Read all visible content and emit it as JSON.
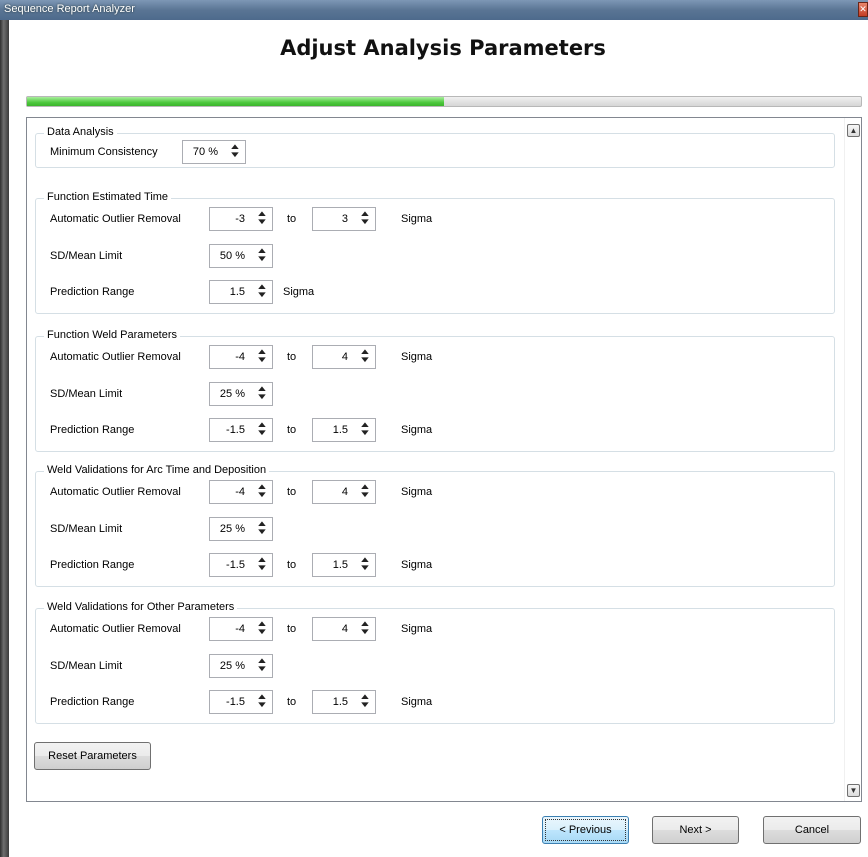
{
  "window": {
    "title": "Sequence Report Analyzer",
    "close_glyph": "✕"
  },
  "page_title": "Adjust Analysis Parameters",
  "progress": {
    "fraction": 0.5
  },
  "groups": [
    {
      "title": "Data Analysis",
      "rows": [
        {
          "label": "Minimum Consistency",
          "from": "70 %"
        }
      ]
    },
    {
      "title": "Function Estimated Time",
      "rows": [
        {
          "label": "Automatic Outlier Removal",
          "from": "-3",
          "to_word": "to",
          "to": "3",
          "unit": "Sigma"
        },
        {
          "label": "SD/Mean Limit",
          "from": "50 %"
        },
        {
          "label": "Prediction Range",
          "from": "1.5",
          "unit": "Sigma"
        }
      ]
    },
    {
      "title": "Function Weld Parameters",
      "rows": [
        {
          "label": "Automatic Outlier Removal",
          "from": "-4",
          "to_word": "to",
          "to": "4",
          "unit": "Sigma"
        },
        {
          "label": "SD/Mean Limit",
          "from": "25 %"
        },
        {
          "label": "Prediction Range",
          "from": "-1.5",
          "to_word": "to",
          "to": "1.5",
          "unit": "Sigma"
        }
      ]
    },
    {
      "title": "Weld Validations for Arc Time and Deposition",
      "rows": [
        {
          "label": "Automatic Outlier Removal",
          "from": "-4",
          "to_word": "to",
          "to": "4",
          "unit": "Sigma"
        },
        {
          "label": "SD/Mean Limit",
          "from": "25 %"
        },
        {
          "label": "Prediction Range",
          "from": "-1.5",
          "to_word": "to",
          "to": "1.5",
          "unit": "Sigma"
        }
      ]
    },
    {
      "title": "Weld Validations for Other Parameters",
      "rows": [
        {
          "label": "Automatic Outlier Removal",
          "from": "-4",
          "to_word": "to",
          "to": "4",
          "unit": "Sigma"
        },
        {
          "label": "SD/Mean Limit",
          "from": "25 %"
        },
        {
          "label": "Prediction Range",
          "from": "-1.5",
          "to_word": "to",
          "to": "1.5",
          "unit": "Sigma"
        }
      ]
    }
  ],
  "reset_label": "Reset Parameters",
  "footer": {
    "previous_label": "< Previous",
    "next_label": "Next >",
    "cancel_label": "Cancel"
  },
  "icons": {
    "spin_up": "▲",
    "spin_down": "▼",
    "scroll_up": "▲",
    "scroll_down": "▼"
  },
  "colors": {
    "progress": "#4ec93e",
    "focus": "#3c7fb1"
  }
}
